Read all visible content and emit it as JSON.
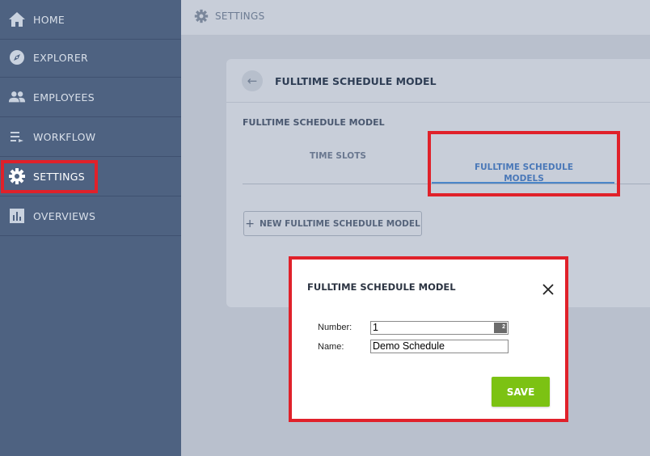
{
  "sidebar": {
    "items": [
      {
        "label": "HOME",
        "icon": "home-icon"
      },
      {
        "label": "EXPLORER",
        "icon": "compass-icon"
      },
      {
        "label": "EMPLOYEES",
        "icon": "people-icon"
      },
      {
        "label": "WORKFLOW",
        "icon": "workflow-icon"
      },
      {
        "label": "SETTINGS",
        "icon": "gear-icon",
        "active": true
      },
      {
        "label": "OVERVIEWS",
        "icon": "chart-icon"
      }
    ]
  },
  "topbar": {
    "title": "SETTINGS",
    "icon": "gear-icon"
  },
  "card": {
    "title": "FULLTIME SCHEDULE MODEL",
    "section_label": "FULLTIME SCHEDULE MODEL",
    "tabs": [
      {
        "label": "TIME SLOTS",
        "active": false
      },
      {
        "label": "FULLTIME SCHEDULE\nMODELS",
        "active": true
      }
    ],
    "new_button_label": "NEW FULLTIME SCHEDULE MODEL"
  },
  "modal": {
    "title": "FULLTIME SCHEDULE MODEL",
    "fields": {
      "number_label": "Number:",
      "number_value": "1",
      "number_button": "2",
      "name_label": "Name:",
      "name_value": "Demo Schedule"
    },
    "save_label": "SAVE"
  },
  "colors": {
    "sidebar": "#4e6281",
    "accent_tab": "#4a78b8",
    "save_button": "#7cc213",
    "highlight": "#e0212a"
  }
}
